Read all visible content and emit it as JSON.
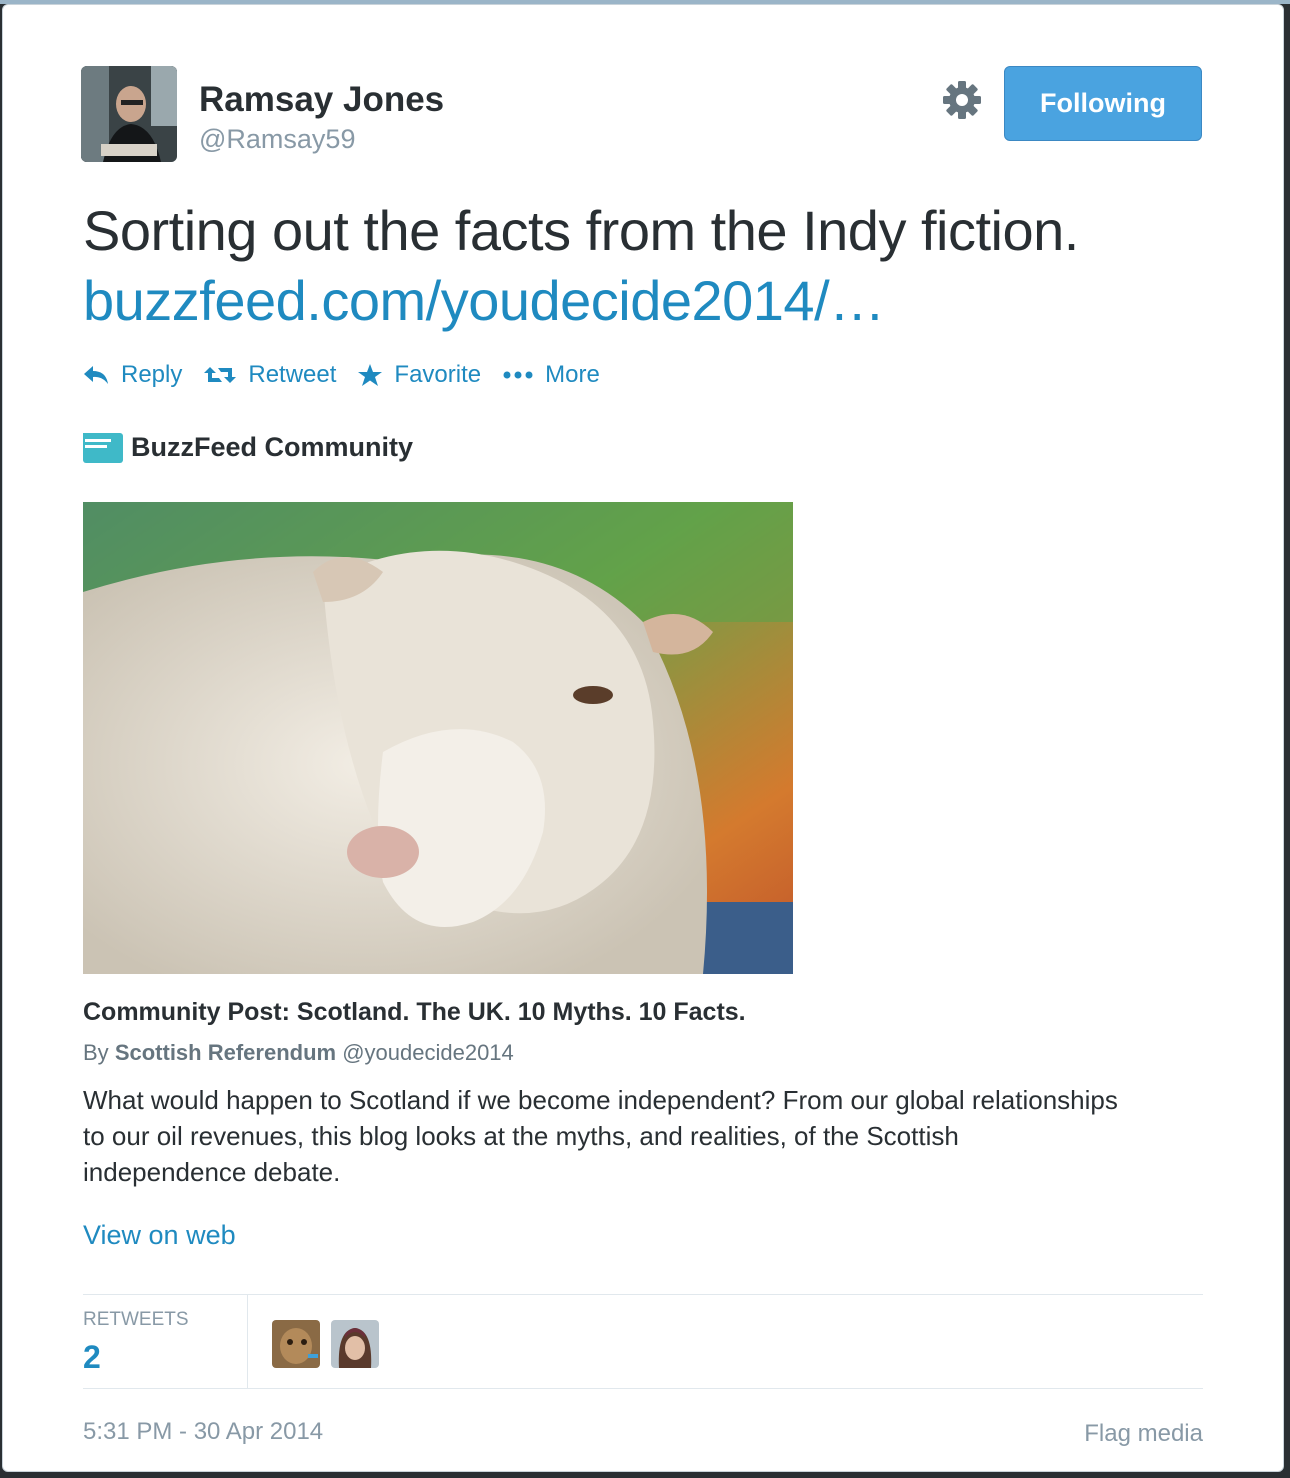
{
  "author": {
    "name": "Ramsay Jones",
    "handle": "@Ramsay59"
  },
  "follow_button": {
    "label": "Following",
    "color": "#4aa3e0"
  },
  "tweet": {
    "text": "Sorting out the facts from the Indy fiction.",
    "link": "buzzfeed.com/youdecide2014/…"
  },
  "actions": [
    {
      "label": "Reply",
      "icon": "reply-icon"
    },
    {
      "label": "Retweet",
      "icon": "retweet-icon"
    },
    {
      "label": "Favorite",
      "icon": "star-icon"
    },
    {
      "label": "More",
      "icon": "more-dots-icon"
    }
  ],
  "card": {
    "source_name": "BuzzFeed Community",
    "source_logo_text": "BuzzFeed Community",
    "title": "Community Post: Scotland. The UK. 10 Myths. 10 Facts.",
    "byline_prefix": "By",
    "byline_author": "Scottish Referendum",
    "byline_handle": "@youdecide2014",
    "summary": "What would happen to Scotland if we become independent? From our global relationships to our oil revenues, this blog looks at the myths, and realities, of the Scottish independence debate.",
    "view_on_web": "View on web"
  },
  "stats": {
    "retweets_label": "RETWEETS",
    "retweets_count": "2"
  },
  "footer": {
    "timestamp": "5:31 PM - 30 Apr 2014",
    "flag_label": "Flag media"
  },
  "colors": {
    "link": "#1f8ac0",
    "text": "#292f33",
    "muted": "#8899a6"
  }
}
